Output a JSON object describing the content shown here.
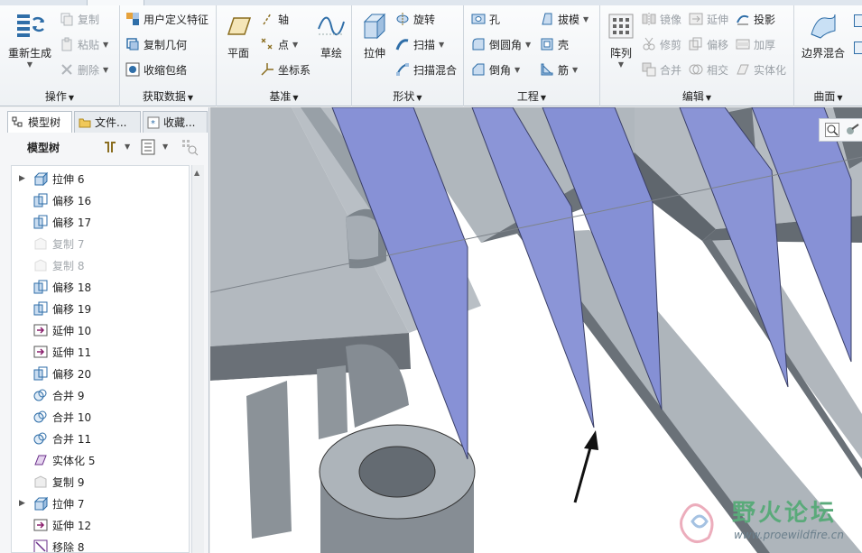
{
  "ribbon": {
    "groups": {
      "operations": {
        "label": "操作",
        "regenerate": "重新生成",
        "copy": "复制",
        "paste": "粘贴",
        "delete": "删除"
      },
      "get_data": {
        "label": "获取数据",
        "udf": "用户定义特征",
        "copy_geometry": "复制几何",
        "shrinkwrap": "收缩包络"
      },
      "datum": {
        "label": "基准",
        "plane": "平面",
        "axis": "轴",
        "point": "点",
        "csys": "坐标系",
        "sketch": "草绘"
      },
      "shapes": {
        "label": "形状",
        "extrude": "拉伸",
        "revolve": "旋转",
        "sweep": "扫描",
        "swept_blend": "扫描混合"
      },
      "engineering": {
        "label": "工程",
        "hole": "孔",
        "round": "倒圆角",
        "chamfer": "倒角",
        "draft": "拔模",
        "shell": "壳",
        "rib": "筋"
      },
      "editing": {
        "label": "编辑",
        "pattern": "阵列",
        "mirror": "镜像",
        "extend": "延伸",
        "project": "投影",
        "trim": "修剪",
        "offset": "偏移",
        "thicken": "加厚",
        "merge": "合并",
        "intersect": "相交",
        "solidify": "实体化"
      },
      "surfaces": {
        "label": "曲面",
        "boundary_blend": "边界混合"
      }
    }
  },
  "panel": {
    "tabs": [
      {
        "label": "模型树"
      },
      {
        "label": "文件..."
      },
      {
        "label": "收藏..."
      }
    ],
    "title": "模型树",
    "tree": [
      {
        "label": "拉伸 6",
        "icon": "extrude-icon",
        "expandable": true,
        "suppressed": false
      },
      {
        "label": "偏移 16",
        "icon": "offset-icon",
        "expandable": false,
        "suppressed": false
      },
      {
        "label": "偏移 17",
        "icon": "offset-icon",
        "expandable": false,
        "suppressed": false
      },
      {
        "label": "复制 7",
        "icon": "copy-icon",
        "expandable": false,
        "suppressed": true
      },
      {
        "label": "复制 8",
        "icon": "copy-icon",
        "expandable": false,
        "suppressed": true
      },
      {
        "label": "偏移 18",
        "icon": "offset-icon",
        "expandable": false,
        "suppressed": false
      },
      {
        "label": "偏移 19",
        "icon": "offset-icon",
        "expandable": false,
        "suppressed": false
      },
      {
        "label": "延伸 10",
        "icon": "extend-icon",
        "expandable": false,
        "suppressed": false
      },
      {
        "label": "延伸 11",
        "icon": "extend-icon",
        "expandable": false,
        "suppressed": false
      },
      {
        "label": "偏移 20",
        "icon": "offset-icon",
        "expandable": false,
        "suppressed": false
      },
      {
        "label": "合并 9",
        "icon": "merge-icon",
        "expandable": false,
        "suppressed": false
      },
      {
        "label": "合并 10",
        "icon": "merge-icon",
        "expandable": false,
        "suppressed": false
      },
      {
        "label": "合并 11",
        "icon": "merge-icon",
        "expandable": false,
        "suppressed": false
      },
      {
        "label": "实体化 5",
        "icon": "solidify-icon",
        "expandable": false,
        "suppressed": false
      },
      {
        "label": "复制 9",
        "icon": "copy-icon",
        "expandable": false,
        "suppressed": false
      },
      {
        "label": "拉伸 7",
        "icon": "extrude-icon",
        "expandable": true,
        "suppressed": false
      },
      {
        "label": "延伸 12",
        "icon": "extend-icon",
        "expandable": false,
        "suppressed": false
      },
      {
        "label": "移除 8",
        "icon": "remove-icon",
        "expandable": false,
        "suppressed": false
      }
    ]
  },
  "watermark": {
    "title": "野火论坛",
    "url": "www.proewildfire.cn"
  },
  "colors": {
    "surface_blue": "#8b96d6",
    "part_gray": "#a9b1b8",
    "part_dark": "#5f666d",
    "accent_blue": "#2f6ea8"
  }
}
